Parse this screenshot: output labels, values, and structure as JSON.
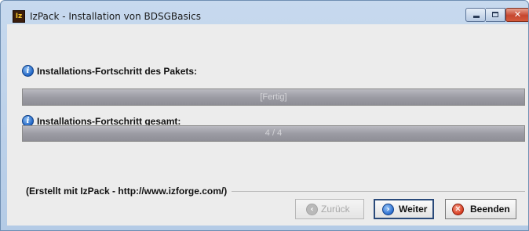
{
  "window": {
    "title": "IzPack - Installation von BDSGBasics",
    "app_icon_text": "Iz",
    "controls": {
      "minimize": "minimize-icon",
      "maximize": "maximize-icon",
      "close": "close-icon",
      "close_glyph": "✕"
    }
  },
  "package_progress": {
    "label": "Installations-Fortschritt des Pakets:",
    "icon": "info-icon",
    "bar_text": "[Fertig]",
    "value_fraction": 1.0
  },
  "overall_progress": {
    "label": "Installations-Fortschritt gesamt:",
    "icon": "info-icon",
    "bar_text": "4 / 4",
    "value_fraction": 1.0
  },
  "footer": {
    "credit": "(Erstellt mit IzPack - http://www.izforge.com/)"
  },
  "buttons": {
    "back": {
      "label": "Zurück",
      "enabled": false,
      "icon": "back-arrow-icon"
    },
    "next": {
      "label": "Weiter",
      "enabled": true,
      "icon": "next-arrow-icon"
    },
    "quit": {
      "label": "Beenden",
      "enabled": true,
      "icon": "quit-icon"
    }
  },
  "info_glyph": "i",
  "colors": {
    "title_bar": "#b9cde6",
    "panel_bg": "#ececec",
    "progress_bar": "#9c9ca4",
    "quit_icon": "#d83c21",
    "next_icon": "#2a6ed0"
  }
}
